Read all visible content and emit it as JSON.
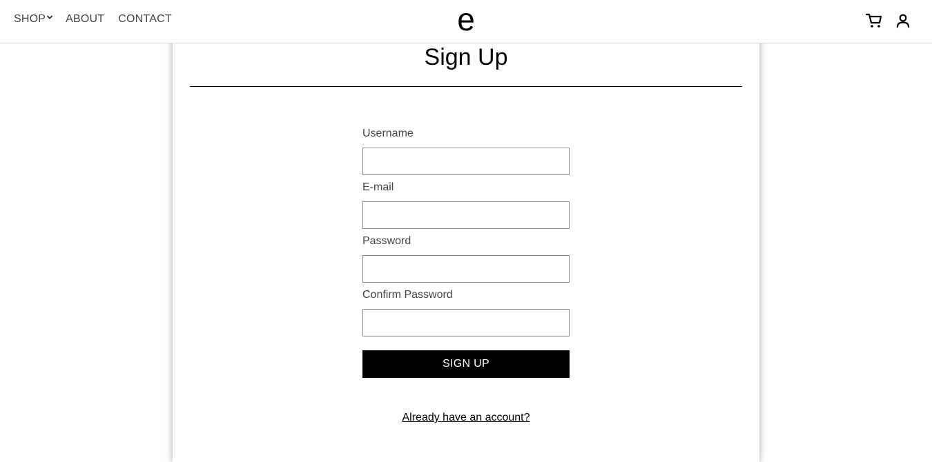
{
  "nav": {
    "shop_label": "SHOP",
    "about_label": "ABOUT",
    "contact_label": "CONTACT"
  },
  "logo": {
    "text": "e"
  },
  "icons": {
    "cart": "shopping-cart-icon",
    "account": "user-icon",
    "shop_dropdown": "chevron-down-icon"
  },
  "signup": {
    "title": "Sign Up",
    "fields": [
      {
        "label": "Username",
        "value": "",
        "placeholder": ""
      },
      {
        "label": "E-mail",
        "value": "",
        "placeholder": ""
      },
      {
        "label": "Password",
        "value": "",
        "placeholder": ""
      },
      {
        "label": "Confirm Password",
        "value": "",
        "placeholder": ""
      }
    ],
    "submit_label": "SIGN UP",
    "login_link_label": "Already have an account?"
  },
  "colors": {
    "button_bg": "#000000",
    "button_text": "#ffffff",
    "header_border": "#d6d6d6"
  }
}
